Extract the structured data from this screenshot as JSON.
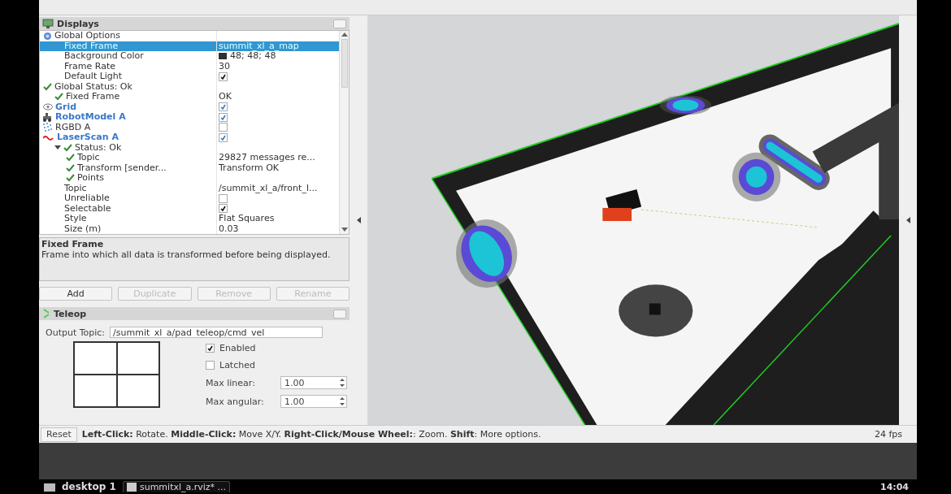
{
  "displays": {
    "title": "Displays",
    "rows": [
      {
        "kind": "group",
        "label": "Global Options",
        "selected": false,
        "children": [
          {
            "kind": "property",
            "label": "Fixed Frame",
            "value": "summit_xl_a_map",
            "selected": true
          },
          {
            "kind": "property",
            "label": "Background Color",
            "value": "48; 48; 48",
            "color": "#303030",
            "selected": false
          },
          {
            "kind": "property",
            "label": "Frame Rate",
            "value": "30",
            "selected": false
          },
          {
            "kind": "property",
            "label": "Default Light",
            "checked": true,
            "selected": false
          }
        ]
      },
      {
        "kind": "status",
        "label": "Global Status: Ok",
        "selected": false,
        "children": [
          {
            "kind": "status",
            "label": "Fixed Frame",
            "value": "OK",
            "selected": false
          }
        ]
      },
      {
        "kind": "display",
        "label": "Grid",
        "checked": true,
        "selected": false
      },
      {
        "kind": "display",
        "label": "RobotModel A",
        "checked": true,
        "selected": false
      },
      {
        "kind": "display",
        "label": "RGBD A",
        "checked": false,
        "selected": false
      },
      {
        "kind": "display",
        "label": "LaserScan A",
        "checked": true,
        "selected": false,
        "children": [
          {
            "kind": "status",
            "label": "Status: Ok",
            "expanded": true,
            "selected": false,
            "children": [
              {
                "kind": "status",
                "label": "Topic",
                "value": "29827 messages re...",
                "selected": false
              },
              {
                "kind": "status",
                "label": "Transform [sender...",
                "value": "Transform OK",
                "selected": false
              },
              {
                "kind": "status",
                "label": "Points",
                "selected": false
              }
            ]
          },
          {
            "kind": "property",
            "label": "Topic",
            "value": "/summit_xl_a/front_l...",
            "selected": false
          },
          {
            "kind": "property",
            "label": "Unreliable",
            "checked": false,
            "selected": false
          },
          {
            "kind": "property",
            "label": "Selectable",
            "checked": true,
            "selected": false
          },
          {
            "kind": "property",
            "label": "Style",
            "value": "Flat Squares",
            "selected": false
          },
          {
            "kind": "property",
            "label": "Size (m)",
            "value": "0.03",
            "selected": false
          }
        ]
      }
    ]
  },
  "description": {
    "title": "Fixed Frame",
    "text": "Frame into which all data is transformed before being displayed."
  },
  "display_buttons": [
    {
      "label": "Add",
      "disabled": false
    },
    {
      "label": "Duplicate",
      "disabled": true
    },
    {
      "label": "Remove",
      "disabled": true
    },
    {
      "label": "Rename",
      "disabled": true
    }
  ],
  "teleop": {
    "title": "Teleop",
    "output_topic_label": "Output Topic:",
    "output_topic": "/summit_xl_a/pad_teleop/cmd_vel",
    "options": [
      {
        "label": "Enabled",
        "checked": true
      },
      {
        "label": "Latched",
        "checked": false
      }
    ],
    "spinners": [
      {
        "label": "Max linear:",
        "value": "1.00"
      },
      {
        "label": "Max angular:",
        "value": "1.00"
      }
    ]
  },
  "status_bar": {
    "reset": "Reset",
    "hint": "**Left-Click:** Rotate. **Middle-Click:** Move X/Y. **Right-Click/Mouse Wheel:**: Zoom. **Shift**: More options.",
    "fps": "24 fps"
  },
  "taskbar": {
    "desktop": "desktop 1",
    "task": "summitxl_a.rviz* ...",
    "time": "14:04"
  }
}
